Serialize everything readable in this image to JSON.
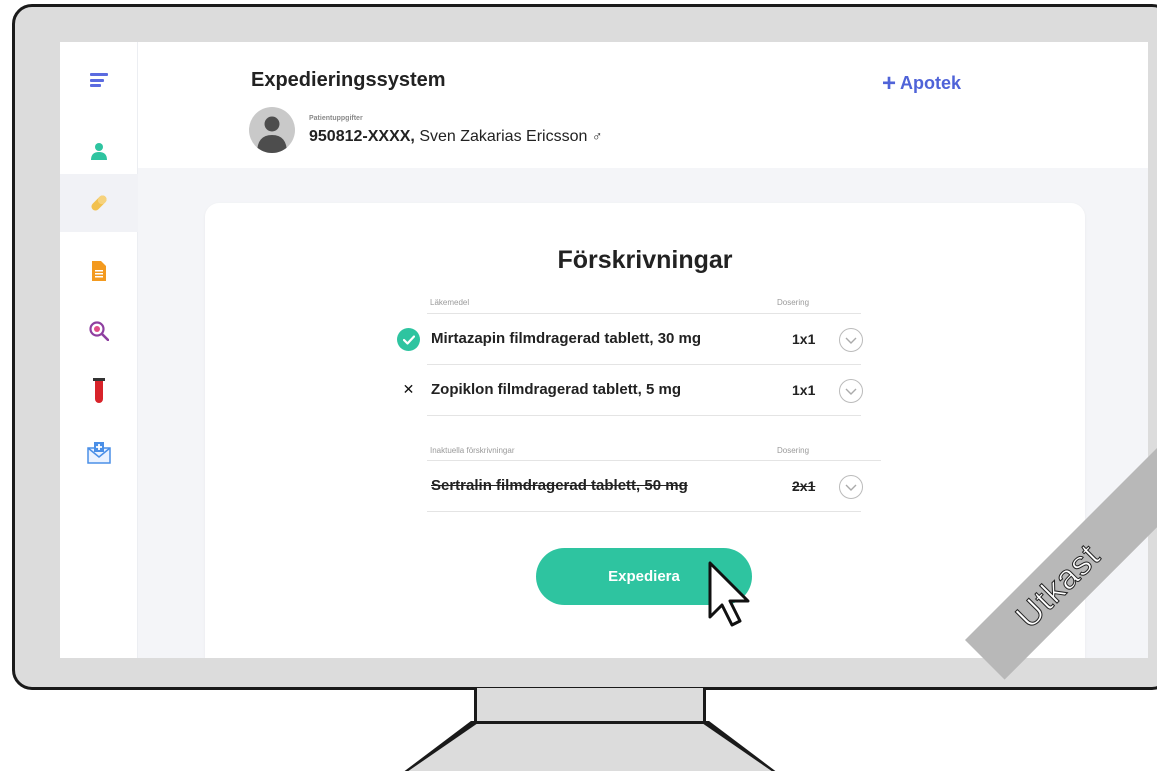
{
  "header": {
    "app_title": "Expedieringssystem",
    "patient_label": "Patientuppgifter",
    "patient_id": "950812-XXXX,",
    "patient_name": "Sven Zakarias Ericsson",
    "gender_symbol": "♂",
    "pharmacy_label": "Apotek",
    "pharmacy_icon": "+"
  },
  "sidebar": {
    "items": [
      {
        "icon": "menu-icon"
      },
      {
        "icon": "patient-icon"
      },
      {
        "icon": "pill-icon",
        "active": true
      },
      {
        "icon": "document-icon"
      },
      {
        "icon": "search-icon"
      },
      {
        "icon": "test-tube-icon"
      },
      {
        "icon": "mail-icon"
      }
    ]
  },
  "prescriptions": {
    "title": "Förskrivningar",
    "active_header": {
      "medicine": "Läkemedel",
      "dosage": "Dosering"
    },
    "active": [
      {
        "name": "Mirtazapin filmdragerad tablett, 30 mg",
        "dose": "1x1",
        "status": "selected"
      },
      {
        "name": "Zopiklon filmdragerad tablett, 5 mg",
        "dose": "1x1",
        "status": "rejected",
        "status_glyph": "✕"
      }
    ],
    "inactive_header": {
      "medicine": "Inaktuella förskrivningar",
      "dosage": "Dosering"
    },
    "inactive": [
      {
        "name": "Sertralin filmdragerad tablett, 50 mg",
        "dose": "2x1"
      }
    ]
  },
  "actions": {
    "dispense_label": "Expediera"
  },
  "watermark": {
    "text": "Utkast"
  },
  "colors": {
    "accent_green": "#2ec4a0",
    "accent_blue": "#4f63d8",
    "pill_yellow": "#f2c14e",
    "doc_orange": "#f39a1f",
    "tube_red": "#d8232a"
  }
}
